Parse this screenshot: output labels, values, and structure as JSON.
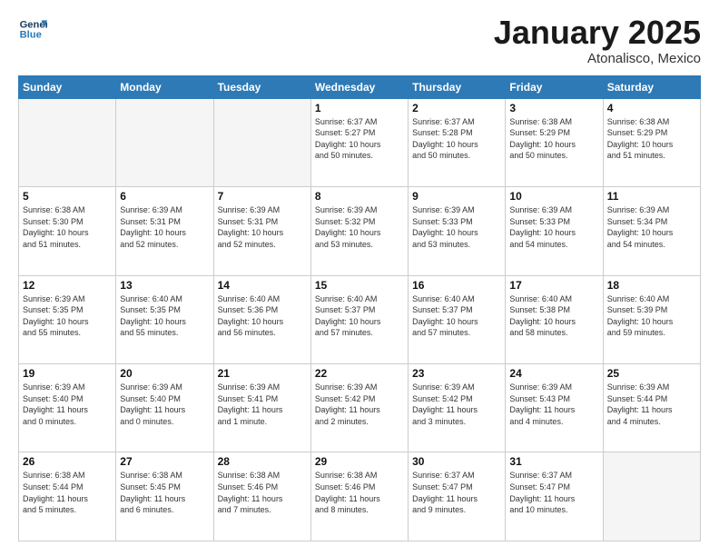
{
  "header": {
    "logo_general": "General",
    "logo_blue": "Blue",
    "month_title": "January 2025",
    "subtitle": "Atonalisco, Mexico"
  },
  "weekdays": [
    "Sunday",
    "Monday",
    "Tuesday",
    "Wednesday",
    "Thursday",
    "Friday",
    "Saturday"
  ],
  "weeks": [
    [
      {
        "day": "",
        "info": ""
      },
      {
        "day": "",
        "info": ""
      },
      {
        "day": "",
        "info": ""
      },
      {
        "day": "1",
        "info": "Sunrise: 6:37 AM\nSunset: 5:27 PM\nDaylight: 10 hours\nand 50 minutes."
      },
      {
        "day": "2",
        "info": "Sunrise: 6:37 AM\nSunset: 5:28 PM\nDaylight: 10 hours\nand 50 minutes."
      },
      {
        "day": "3",
        "info": "Sunrise: 6:38 AM\nSunset: 5:29 PM\nDaylight: 10 hours\nand 50 minutes."
      },
      {
        "day": "4",
        "info": "Sunrise: 6:38 AM\nSunset: 5:29 PM\nDaylight: 10 hours\nand 51 minutes."
      }
    ],
    [
      {
        "day": "5",
        "info": "Sunrise: 6:38 AM\nSunset: 5:30 PM\nDaylight: 10 hours\nand 51 minutes."
      },
      {
        "day": "6",
        "info": "Sunrise: 6:39 AM\nSunset: 5:31 PM\nDaylight: 10 hours\nand 52 minutes."
      },
      {
        "day": "7",
        "info": "Sunrise: 6:39 AM\nSunset: 5:31 PM\nDaylight: 10 hours\nand 52 minutes."
      },
      {
        "day": "8",
        "info": "Sunrise: 6:39 AM\nSunset: 5:32 PM\nDaylight: 10 hours\nand 53 minutes."
      },
      {
        "day": "9",
        "info": "Sunrise: 6:39 AM\nSunset: 5:33 PM\nDaylight: 10 hours\nand 53 minutes."
      },
      {
        "day": "10",
        "info": "Sunrise: 6:39 AM\nSunset: 5:33 PM\nDaylight: 10 hours\nand 54 minutes."
      },
      {
        "day": "11",
        "info": "Sunrise: 6:39 AM\nSunset: 5:34 PM\nDaylight: 10 hours\nand 54 minutes."
      }
    ],
    [
      {
        "day": "12",
        "info": "Sunrise: 6:39 AM\nSunset: 5:35 PM\nDaylight: 10 hours\nand 55 minutes."
      },
      {
        "day": "13",
        "info": "Sunrise: 6:40 AM\nSunset: 5:35 PM\nDaylight: 10 hours\nand 55 minutes."
      },
      {
        "day": "14",
        "info": "Sunrise: 6:40 AM\nSunset: 5:36 PM\nDaylight: 10 hours\nand 56 minutes."
      },
      {
        "day": "15",
        "info": "Sunrise: 6:40 AM\nSunset: 5:37 PM\nDaylight: 10 hours\nand 57 minutes."
      },
      {
        "day": "16",
        "info": "Sunrise: 6:40 AM\nSunset: 5:37 PM\nDaylight: 10 hours\nand 57 minutes."
      },
      {
        "day": "17",
        "info": "Sunrise: 6:40 AM\nSunset: 5:38 PM\nDaylight: 10 hours\nand 58 minutes."
      },
      {
        "day": "18",
        "info": "Sunrise: 6:40 AM\nSunset: 5:39 PM\nDaylight: 10 hours\nand 59 minutes."
      }
    ],
    [
      {
        "day": "19",
        "info": "Sunrise: 6:39 AM\nSunset: 5:40 PM\nDaylight: 11 hours\nand 0 minutes."
      },
      {
        "day": "20",
        "info": "Sunrise: 6:39 AM\nSunset: 5:40 PM\nDaylight: 11 hours\nand 0 minutes."
      },
      {
        "day": "21",
        "info": "Sunrise: 6:39 AM\nSunset: 5:41 PM\nDaylight: 11 hours\nand 1 minute."
      },
      {
        "day": "22",
        "info": "Sunrise: 6:39 AM\nSunset: 5:42 PM\nDaylight: 11 hours\nand 2 minutes."
      },
      {
        "day": "23",
        "info": "Sunrise: 6:39 AM\nSunset: 5:42 PM\nDaylight: 11 hours\nand 3 minutes."
      },
      {
        "day": "24",
        "info": "Sunrise: 6:39 AM\nSunset: 5:43 PM\nDaylight: 11 hours\nand 4 minutes."
      },
      {
        "day": "25",
        "info": "Sunrise: 6:39 AM\nSunset: 5:44 PM\nDaylight: 11 hours\nand 4 minutes."
      }
    ],
    [
      {
        "day": "26",
        "info": "Sunrise: 6:38 AM\nSunset: 5:44 PM\nDaylight: 11 hours\nand 5 minutes."
      },
      {
        "day": "27",
        "info": "Sunrise: 6:38 AM\nSunset: 5:45 PM\nDaylight: 11 hours\nand 6 minutes."
      },
      {
        "day": "28",
        "info": "Sunrise: 6:38 AM\nSunset: 5:46 PM\nDaylight: 11 hours\nand 7 minutes."
      },
      {
        "day": "29",
        "info": "Sunrise: 6:38 AM\nSunset: 5:46 PM\nDaylight: 11 hours\nand 8 minutes."
      },
      {
        "day": "30",
        "info": "Sunrise: 6:37 AM\nSunset: 5:47 PM\nDaylight: 11 hours\nand 9 minutes."
      },
      {
        "day": "31",
        "info": "Sunrise: 6:37 AM\nSunset: 5:47 PM\nDaylight: 11 hours\nand 10 minutes."
      },
      {
        "day": "",
        "info": ""
      }
    ]
  ]
}
